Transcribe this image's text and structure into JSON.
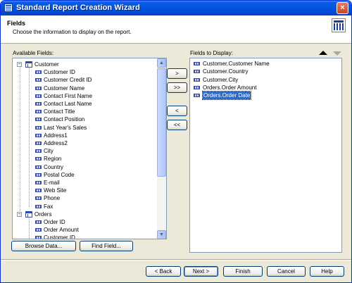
{
  "window": {
    "title": "Standard Report Creation Wizard",
    "close_symbol": "×"
  },
  "header": {
    "title": "Fields",
    "subtitle": "Choose the information to display on the report."
  },
  "available": {
    "label": "Available Fields:",
    "tables": [
      {
        "name": "Customer",
        "expander": "−",
        "fields": [
          "Customer ID",
          "Customer Credit ID",
          "Customer Name",
          "Contact First Name",
          "Contact Last Name",
          "Contact Title",
          "Contact Position",
          "Last Year's Sales",
          "Address1",
          "Address2",
          "City",
          "Region",
          "Country",
          "Postal Code",
          "E-mail",
          "Web Site",
          "Phone",
          "Fax"
        ]
      },
      {
        "name": "Orders",
        "expander": "−",
        "fields": [
          "Order ID",
          "Order Amount",
          "Customer ID"
        ]
      }
    ],
    "scroll_up": "▲",
    "scroll_down": "▼"
  },
  "display": {
    "label": "Fields to Display:",
    "fields": [
      "Customer.Customer Name",
      "Customer.Country",
      "Customer.City",
      "Orders.Order Amount",
      "Orders.Order Date"
    ],
    "selected_index": 4
  },
  "transfer_buttons": {
    "add": ">",
    "add_all": ">>",
    "remove": "<",
    "remove_all": "<<"
  },
  "actions": {
    "browse": "Browse Data...",
    "find": "Find Field..."
  },
  "footer": {
    "back": "< Back",
    "next": "Next >",
    "finish": "Finish",
    "cancel": "Cancel",
    "help": "Help"
  }
}
